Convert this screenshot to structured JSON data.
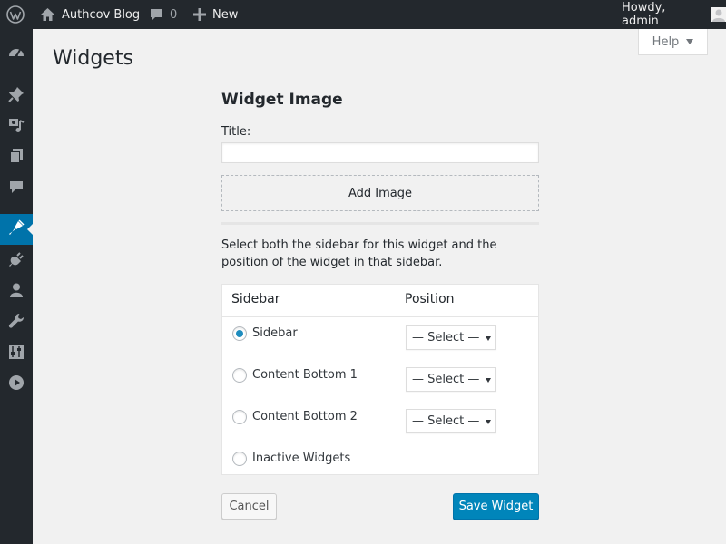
{
  "admin_bar": {
    "site_name": "Authcov Blog",
    "comments_count": "0",
    "new_label": "New",
    "greeting": "Howdy, admin"
  },
  "admin_menu": {
    "items": [
      {
        "icon": "dashboard-icon"
      },
      {
        "icon": "pushpin-icon"
      },
      {
        "icon": "media-icon"
      },
      {
        "icon": "pages-icon"
      },
      {
        "icon": "comments-icon"
      },
      {
        "icon": "appearance-icon",
        "current": true
      },
      {
        "icon": "plugins-icon"
      },
      {
        "icon": "users-icon"
      },
      {
        "icon": "tools-icon"
      },
      {
        "icon": "settings-icon"
      },
      {
        "icon": "play-icon"
      }
    ]
  },
  "help_tab": {
    "label": "Help"
  },
  "page": {
    "title": "Widgets"
  },
  "widget": {
    "heading": "Widget Image",
    "title_label": "Title:",
    "title_value": "",
    "add_image_label": "Add Image",
    "help_text": "Select both the sidebar for this widget and the position of the widget in that sidebar.",
    "table_headers": {
      "sidebar": "Sidebar",
      "position": "Position"
    },
    "rows": [
      {
        "label": "Sidebar",
        "checked": true,
        "position": "— Select —"
      },
      {
        "label": "Content Bottom 1",
        "checked": false,
        "position": "— Select —"
      },
      {
        "label": "Content Bottom 2",
        "checked": false,
        "position": "— Select —"
      },
      {
        "label": "Inactive Widgets",
        "checked": false
      }
    ],
    "cancel_label": "Cancel",
    "save_label": "Save Widget"
  },
  "colors": {
    "admin_bar_bg": "#23282d",
    "accent": "#0073aa",
    "primary_button": "#0085ba",
    "radio_checked": "#1e8cbe"
  }
}
